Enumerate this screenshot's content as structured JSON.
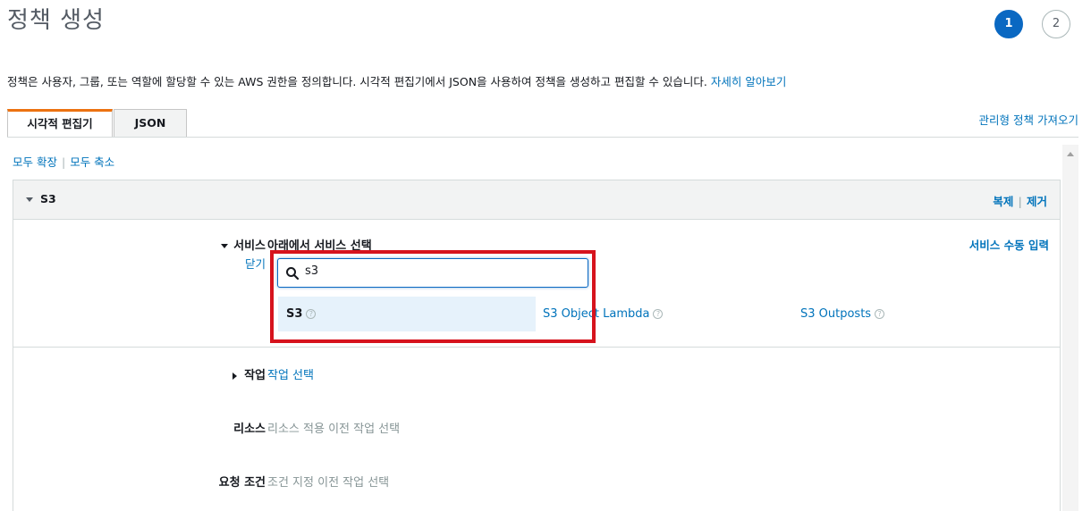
{
  "page": {
    "title": "정책 생성",
    "steps": [
      "1",
      "2"
    ],
    "intro_text": "정책은 사용자, 그룹, 또는 역할에 할당할 수 있는 AWS 권한을 정의합니다. 시각적 편집기에서 JSON을 사용하여 정책을 생성하고 편집할 수 있습니다. ",
    "learn_more": "자세히 알아보기"
  },
  "tabs": {
    "visual": "시각적 편집기",
    "json": "JSON",
    "import_managed": "관리형 정책 가져오기"
  },
  "expand": {
    "expand_all": "모두 확장",
    "collapse_all": "모두 축소"
  },
  "panel": {
    "title": "S3",
    "clone": "복제",
    "remove": "제거",
    "service_label": "서비스",
    "close": "닫기",
    "service_select": "아래에서 서비스 선택",
    "manual_input": "서비스 수동 입력",
    "search_value": "s3",
    "options": [
      "S3",
      "S3 Object Lambda",
      "S3 Outposts"
    ],
    "help_glyph": "?",
    "action_label": "작업",
    "action_value": "작업 선택",
    "resource_label": "리소스",
    "resource_value": "리소스 적용 이전 작업 선택",
    "condition_label": "요청 조건",
    "condition_value": "조건 지정 이전 작업 선택"
  },
  "colors": {
    "accent": "#0a68c2",
    "link": "#0073bb",
    "tab_active": "#ec7211",
    "highlight": "#d6131d",
    "selected_option": "#e6f2fb"
  }
}
